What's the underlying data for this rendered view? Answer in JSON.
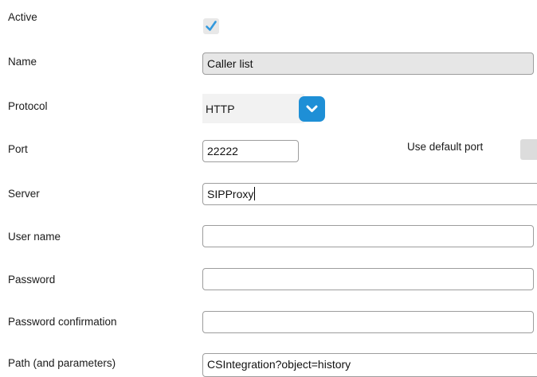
{
  "form": {
    "active": {
      "label": "Active",
      "checked": true,
      "check_icon": "checkmark-icon"
    },
    "name": {
      "label": "Name",
      "value": "Caller list"
    },
    "protocol": {
      "label": "Protocol",
      "value": "HTTP",
      "dropdown_icon": "chevron-down-icon"
    },
    "port": {
      "label": "Port",
      "value": "22222",
      "default_label": "Use default port",
      "default_checked": false
    },
    "server": {
      "label": "Server",
      "value": "SIPProxy"
    },
    "user_name": {
      "label": "User name",
      "value": ""
    },
    "password": {
      "label": "Password",
      "value": ""
    },
    "password_confirmation": {
      "label": "Password confirmation",
      "value": ""
    },
    "path": {
      "label": "Path (and parameters)",
      "value": "CSIntegration?object=history"
    }
  },
  "colors": {
    "accent": "#1e8fd6",
    "checkmark": "#3399dd",
    "readonly_field": "#e6e6e6",
    "field_border": "#9d9d9d"
  }
}
